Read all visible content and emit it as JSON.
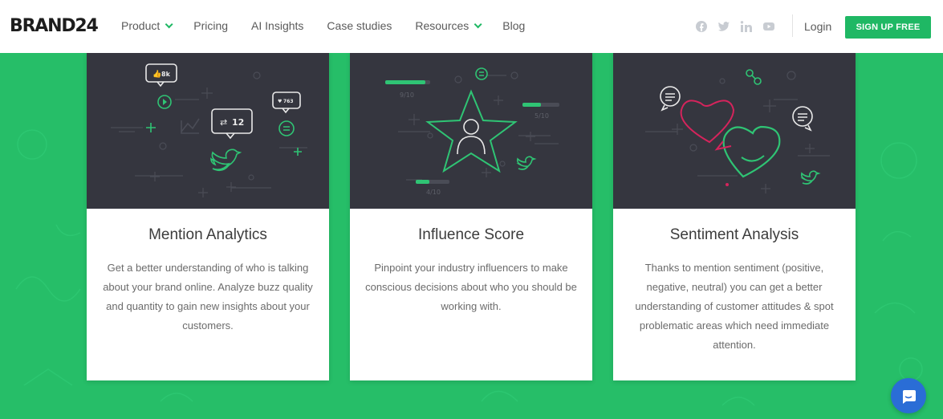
{
  "header": {
    "logo": "BRAND24",
    "nav": [
      {
        "label": "Product",
        "dropdown": true
      },
      {
        "label": "Pricing",
        "dropdown": false
      },
      {
        "label": "AI Insights",
        "dropdown": false
      },
      {
        "label": "Case studies",
        "dropdown": false
      },
      {
        "label": "Resources",
        "dropdown": true
      },
      {
        "label": "Blog",
        "dropdown": false
      }
    ],
    "socials": [
      "facebook-icon",
      "twitter-icon",
      "linkedin-icon",
      "youtube-icon"
    ],
    "login": "Login",
    "signup": "SIGN UP FREE"
  },
  "colors": {
    "brand_green": "#26be68",
    "button_green": "#1fb864",
    "card_dark": "#35363f",
    "illus_green": "#2fc474",
    "illus_pink": "#d5245c",
    "chat_blue": "#2a6dd6"
  },
  "cards": [
    {
      "title": "Mention Analytics",
      "text": "Get a better understanding of who is talking about your brand online. Analyze buzz quality and quantity to gain new insights about your customers.",
      "illustration": {
        "like_count": "8k",
        "retweet_count": "12",
        "heart_count": "763"
      }
    },
    {
      "title": "Influence Score",
      "text": "Pinpoint your industry influencers to make conscious decisions about who you should be working with.",
      "illustration": {
        "scores": [
          {
            "label": "9/10",
            "value": 0.9
          },
          {
            "label": "5/10",
            "value": 0.5
          },
          {
            "label": "4/10",
            "value": 0.4
          }
        ]
      }
    },
    {
      "title": "Sentiment Analysis",
      "text": "Thanks to mention sentiment (positive, negative, neutral) you can get a better understanding of customer attitudes & spot problematic areas which need immediate attention.",
      "illustration": {}
    }
  ],
  "chat_widget": "chat-icon"
}
